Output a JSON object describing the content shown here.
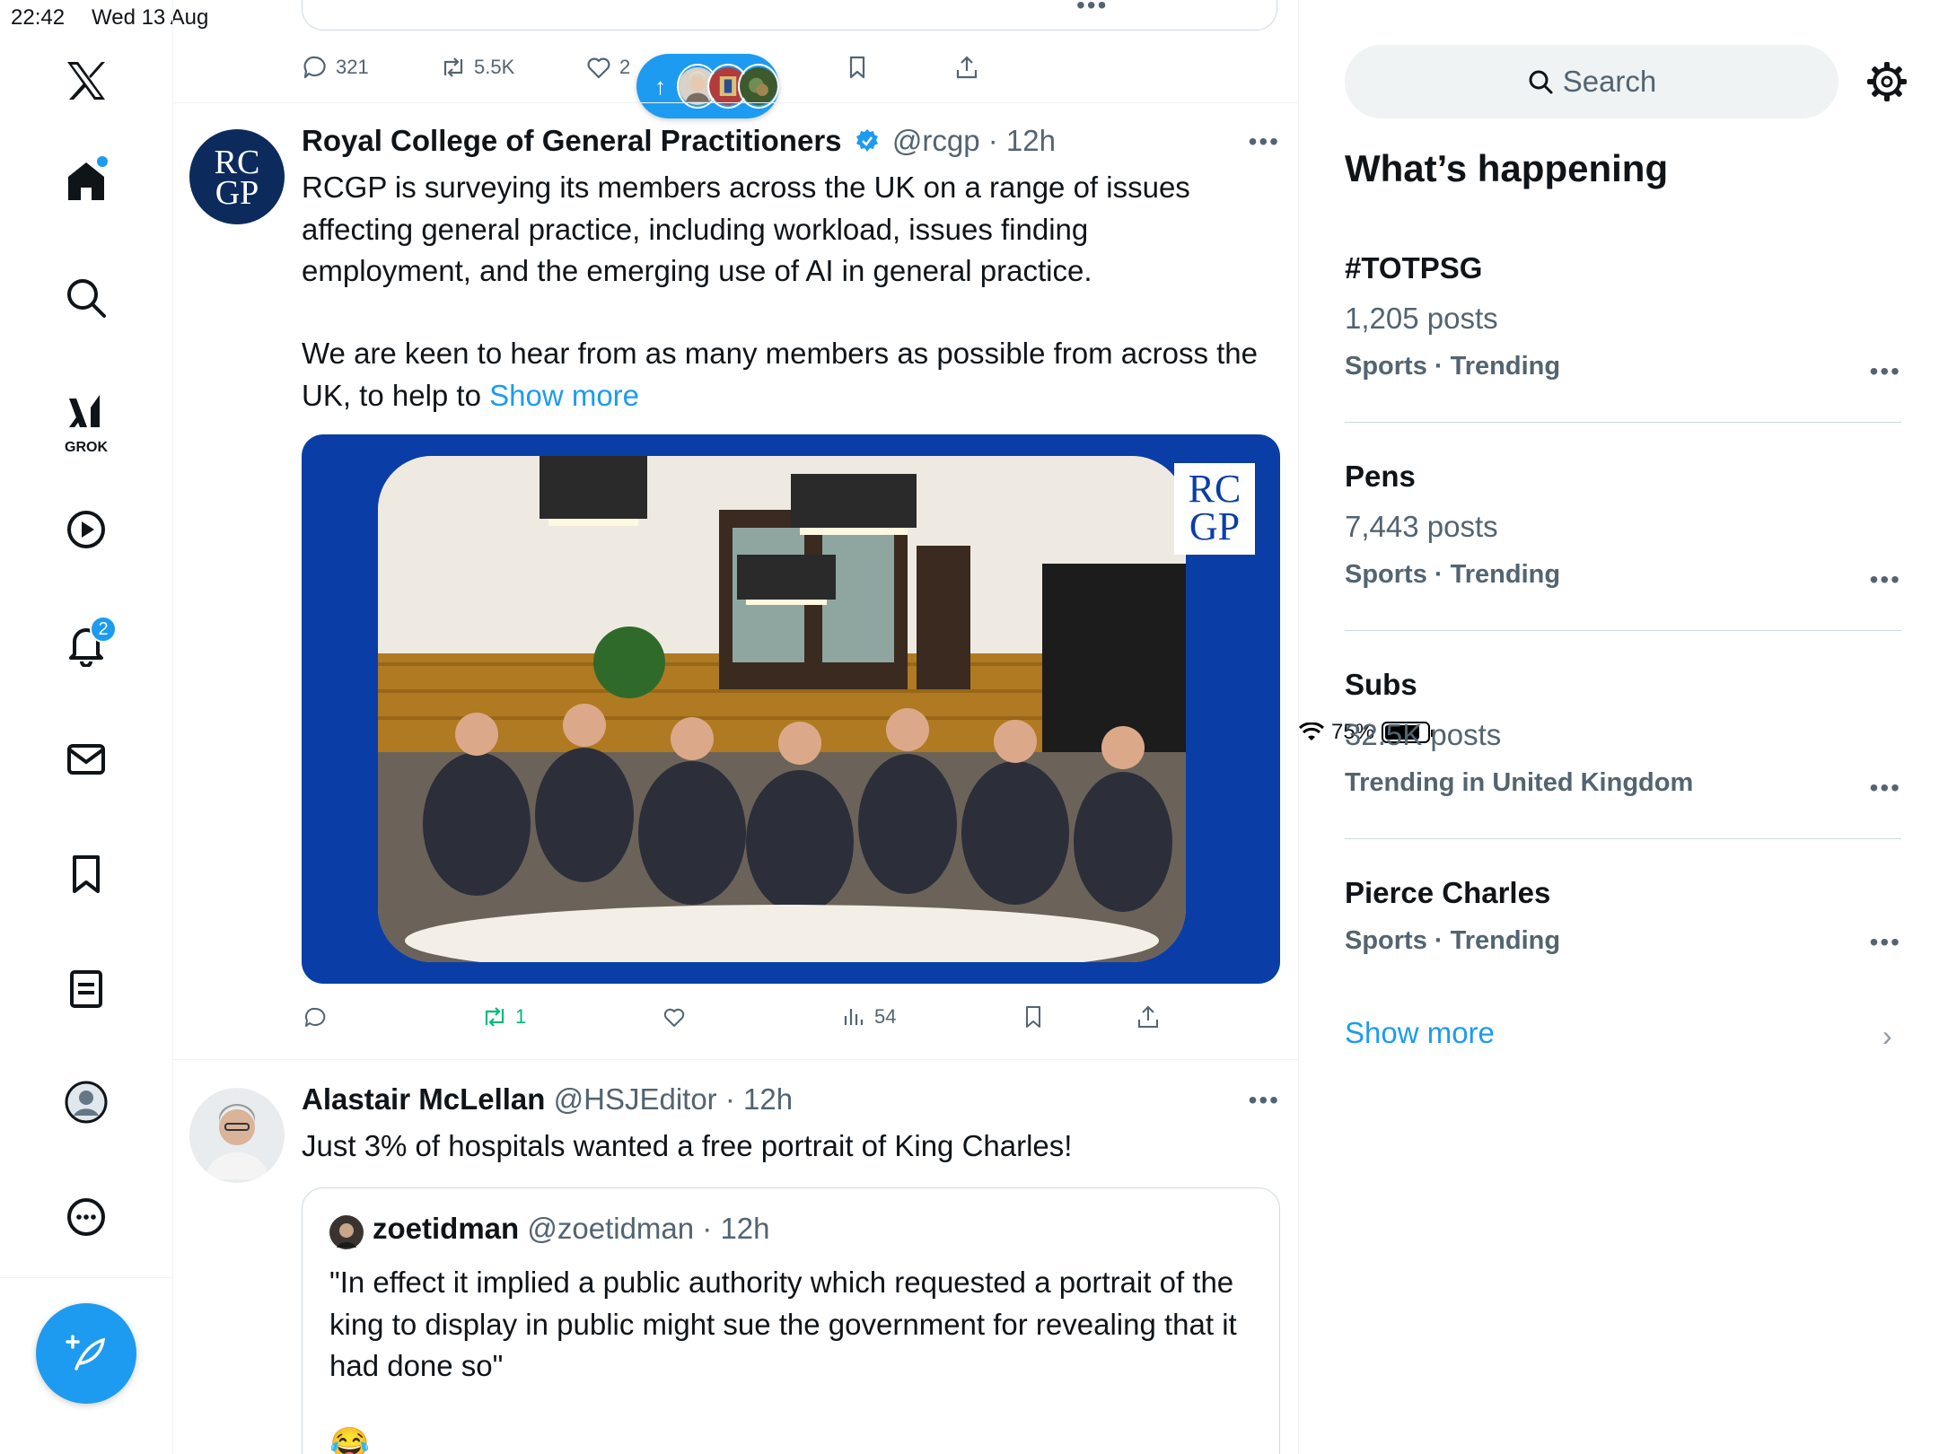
{
  "status_bar": {
    "time": "22:42",
    "date": "Wed 13 Aug",
    "battery": "75%",
    "battery_level": 0.75
  },
  "nav": {
    "items": [
      "home",
      "explore",
      "grok",
      "video",
      "notifications",
      "messages",
      "bookmarks",
      "lists",
      "profile",
      "more"
    ],
    "grok_label": "GROK",
    "notifications_badge": "2"
  },
  "feed": {
    "previous_post_actions": {
      "replies": "321",
      "reposts": "5.5K",
      "likes": "2"
    },
    "post1": {
      "name": "Royal College of General Practitioners",
      "handle": "@rcgp",
      "time": "· 12h",
      "avatar_text": "RC\nGP",
      "text_p1": "RCGP is surveying its members across the UK on a range of issues affecting general practice, including workload, issues finding employment, and the emerging use of AI in general practice.",
      "text_p2": "We are keen to hear from as many members as possible from across the UK, to help to ",
      "show_more": "Show more",
      "logo_text": "RC\nGP",
      "actions": {
        "replies": "",
        "reposts": "1",
        "likes": "",
        "views": "54"
      }
    },
    "post2": {
      "name": "Alastair McLellan",
      "handle": "@HSJEditor",
      "time": "· 12h",
      "text": "Just 3% of hospitals wanted a free portrait of King Charles!",
      "quote": {
        "name": "zoetidman",
        "handle": "@zoetidman",
        "time": "· 12h",
        "text": "\"In effect it implied a public authority which requested a portrait of the king to display in public might sue the government for revealing that it had done so\"",
        "emoji": "😂"
      }
    }
  },
  "sidebar": {
    "search_placeholder": "Search",
    "title": "What’s happening",
    "trends": [
      {
        "name": "#TOTPSG",
        "count": "1,205 posts",
        "context": "Sports · Trending"
      },
      {
        "name": "Pens",
        "count": "7,443 posts",
        "context": "Sports · Trending"
      },
      {
        "name": "Subs",
        "count": "32.5K posts",
        "context": "Trending in United Kingdom"
      },
      {
        "name": "Pierce Charles",
        "count": "",
        "context": "Sports · Trending"
      }
    ],
    "show_more": "Show more"
  },
  "colors": {
    "accent": "#1d9bf0",
    "text": "#0f1419",
    "secondary": "#536471",
    "media_bg": "#0a3ea6",
    "repost_active": "#00ba7c"
  }
}
